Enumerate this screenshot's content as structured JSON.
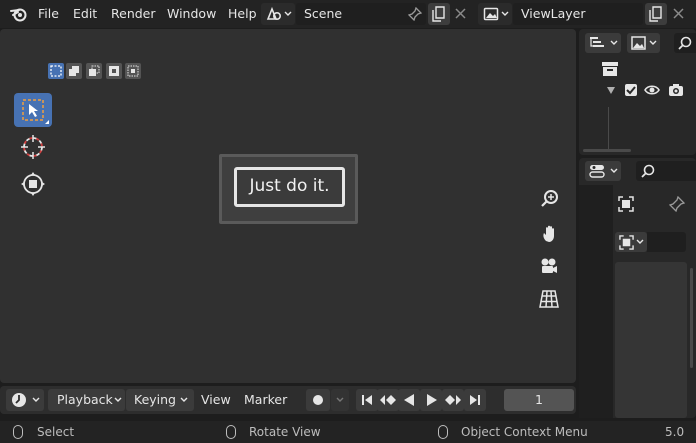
{
  "menu": {
    "file": "File",
    "edit": "Edit",
    "render": "Render",
    "window": "Window",
    "help": "Help"
  },
  "scene": {
    "name": "Scene"
  },
  "view_layer": {
    "name": "ViewLayer"
  },
  "popup": {
    "message": "Just do it."
  },
  "timeline": {
    "playback": "Playback",
    "keying": "Keying",
    "view": "View",
    "marker": "Marker",
    "current_frame": "1"
  },
  "status": {
    "select": "Select",
    "rotate_view": "Rotate View",
    "context_menu": "Object Context Menu",
    "version": "5.0"
  },
  "icons": [
    "blender-logo-icon",
    "scene-icon",
    "pin-icon",
    "new-icon",
    "close-icon",
    "view-layer-icon",
    "select-box-icon",
    "cursor-icon",
    "move-icon",
    "zoom-icon",
    "hand-icon",
    "camera-icon",
    "grid-icon",
    "record-icon",
    "jump-start-icon",
    "prev-keyframe-icon",
    "play-reverse-icon",
    "play-icon",
    "next-keyframe-icon",
    "jump-end-icon",
    "outliner-icon",
    "collection-icon",
    "eye-icon",
    "render-camera-icon",
    "search-icon",
    "properties-icon",
    "mouse-icon"
  ],
  "colors": {
    "accent": "#4772b3",
    "background": "#303030",
    "panel": "#282828"
  }
}
